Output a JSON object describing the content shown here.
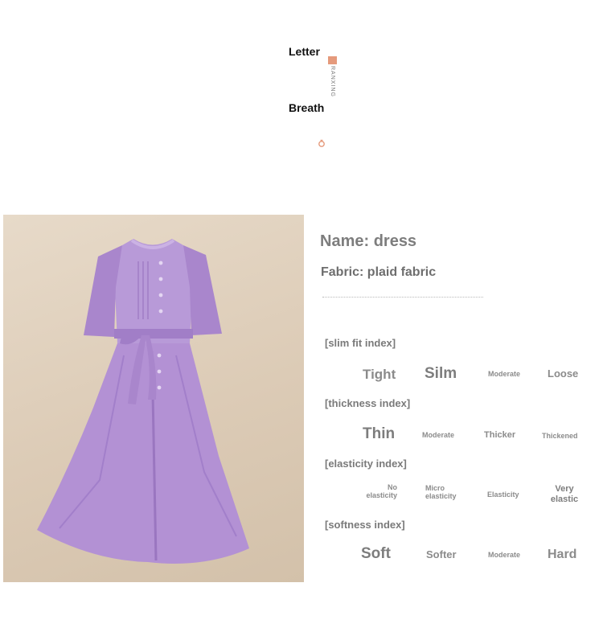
{
  "brand": {
    "word_top": "Letter",
    "word_bottom": "Breath",
    "vertical_text": "RANXING",
    "accent_color": "#e59a7c"
  },
  "product": {
    "name": "Name: dress",
    "fabric": "Fabric: plaid fabric",
    "image_alt": "Purple short-sleeve midi dress with ruffled collar and tie belt"
  },
  "indices": [
    {
      "label": "[slim fit index]",
      "options": [
        "Tight",
        "Silm",
        "Moderate",
        "Loose"
      ],
      "selected": "Silm"
    },
    {
      "label": "[thickness index]",
      "options": [
        "Thin",
        "Moderate",
        "Thicker",
        "Thickened"
      ],
      "selected": "Thin"
    },
    {
      "label": "[elasticity index]",
      "options": [
        "No elasticity",
        "Micro elasticity",
        "Elasticity",
        "Very elastic"
      ],
      "selected": "Very elastic"
    },
    {
      "label": "[softness index]",
      "options": [
        "Soft",
        "Softer",
        "Moderate",
        "Hard"
      ],
      "selected": "Soft"
    }
  ],
  "colors": {
    "dress": "#b391d4",
    "dress_shadow": "#9a76c0",
    "background": "#e2d4c2"
  }
}
